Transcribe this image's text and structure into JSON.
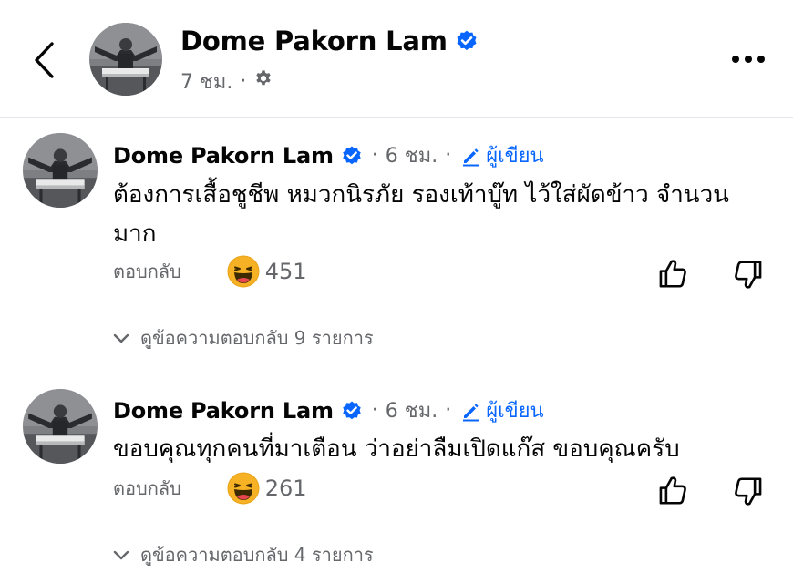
{
  "header": {
    "name": "Dome Pakorn Lam",
    "time": "7 ชม.",
    "separator": "·"
  },
  "comments": [
    {
      "name": "Dome Pakorn Lam",
      "time": "6 ชม.",
      "author_label": "ผู้เขียน",
      "text": "ต้องการเสื้อชูชีพ หมวกนิรภัย รองเท้าบู๊ท ไว้ใส่ผัดข้าว จำนวนมาก",
      "reply_label": "ตอบกลับ",
      "reaction_count": "451",
      "view_replies": "ดูข้อความตอบกลับ 9 รายการ"
    },
    {
      "name": "Dome Pakorn Lam",
      "time": "6 ชม.",
      "author_label": "ผู้เขียน",
      "text": "ขอบคุณทุกคนที่มาเตือน ว่าอย่าลืมเปิดแก๊ส ขอบคุณครับ",
      "reply_label": "ตอบกลับ",
      "reaction_count": "261",
      "view_replies": "ดูข้อความตอบกลับ 4 รายการ"
    }
  ],
  "colors": {
    "accent": "#0866ff",
    "secondary_text": "#65676b",
    "reaction": "#f7b125"
  },
  "icons": [
    "back-arrow-icon",
    "verified-badge-icon",
    "gear-icon",
    "more-icon",
    "pencil-icon",
    "haha-reaction-icon",
    "thumbs-up-icon",
    "thumbs-down-icon",
    "chevron-down-icon"
  ]
}
